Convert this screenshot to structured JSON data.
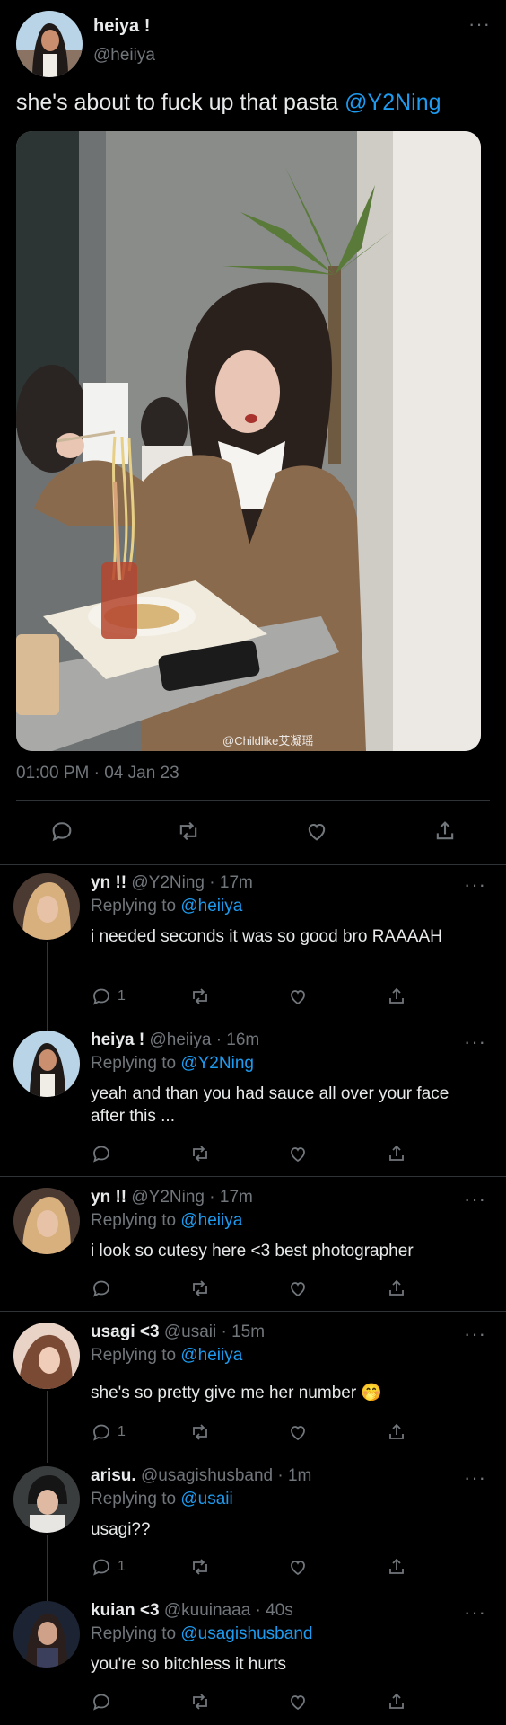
{
  "main_tweet": {
    "name": "heiya !",
    "handle": "@heiiya",
    "text": "she's about to fuck up that pasta",
    "mention": "@Y2Ning",
    "watermark": "@Childlike艾凝瑶",
    "timestamp": "01:00 PM · 04 Jan 23",
    "more_icon": "more-dots-icon"
  },
  "replies": [
    {
      "name": "yn !!",
      "meta": "@Y2Ning · 17m",
      "replying_label": "Replying to",
      "replying_to": "@heiiya",
      "text": "i needed seconds it was so good bro RAAAAH",
      "reply_count": "1"
    },
    {
      "name": "heiya !",
      "meta": "@heiiya · 16m",
      "replying_label": "Replying to",
      "replying_to": "@Y2Ning",
      "text": "yeah and than you had sauce all over your face after this ...",
      "reply_count": ""
    },
    {
      "name": "yn !!",
      "meta": "@Y2Ning · 17m",
      "replying_label": "Replying to",
      "replying_to": "@heiiya",
      "text": "i look so cutesy here <3 best photographer",
      "reply_count": ""
    },
    {
      "name": "usagi <3",
      "meta": "@usaii · 15m",
      "replying_label": "Replying to",
      "replying_to": "@heiiya",
      "text": "she's so pretty give me her number 🤭",
      "reply_count": "1"
    },
    {
      "name": "arisu.",
      "meta": "@usagishusband · 1m",
      "replying_label": "Replying to",
      "replying_to": "@usaii",
      "text": "usagi??",
      "reply_count": "1"
    },
    {
      "name": "kuian <3",
      "meta": "@kuuinaaa · 40s",
      "replying_label": "Replying to",
      "replying_to": "@usagishusband",
      "text": "you're so bitchless it hurts",
      "reply_count": ""
    }
  ],
  "colors": {
    "background": "#000000",
    "text": "#e7e9ea",
    "muted": "#71767b",
    "link": "#1d9bf0",
    "divider": "#2f3336"
  },
  "icons": [
    "reply-icon",
    "retweet-icon",
    "like-icon",
    "share-icon"
  ]
}
